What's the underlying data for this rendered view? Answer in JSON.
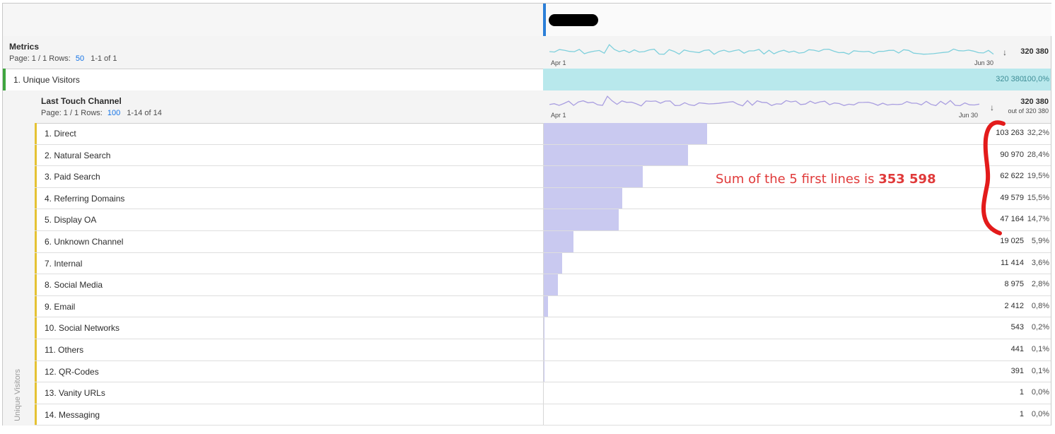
{
  "header": {},
  "metrics_panel": {
    "title": "Metrics",
    "page_label": "Page: 1 / 1 Rows:",
    "rows_value": "50",
    "range": "1-1 of 1",
    "spark_start": "Apr 1",
    "spark_end": "Jun 30",
    "total": "320 380",
    "sort_icon": "arrow-down-icon",
    "spark_color": "#7fd0dc"
  },
  "unique_visitors": {
    "label": "1. Unique Visitors",
    "value": "320 380",
    "pct": "100,0%",
    "bar_color": "#b8e8ec",
    "marker_color": "#3fa53f"
  },
  "breakdown": {
    "title": "Last Touch Channel",
    "page_label": "Page: 1 / 1 Rows:",
    "rows_value": "100",
    "range": "1-14 of 14",
    "spark_start": "Apr 1",
    "spark_end": "Jun 30",
    "total": "320 380",
    "out_of": "out of 320 380",
    "spark_color": "#a99ee0",
    "side_label": "Unique Visitors",
    "bar_color": "#c9c9f0",
    "marker_color": "#e5c234"
  },
  "rows": [
    {
      "label": "1. Direct",
      "value": "103 263",
      "pct": "32,2%",
      "share": 0.322
    },
    {
      "label": "2. Natural Search",
      "value": "90 970",
      "pct": "28,4%",
      "share": 0.284
    },
    {
      "label": "3. Paid Search",
      "value": "62 622",
      "pct": "19,5%",
      "share": 0.195
    },
    {
      "label": "4. Referring Domains",
      "value": "49 579",
      "pct": "15,5%",
      "share": 0.155
    },
    {
      "label": "5. Display OA",
      "value": "47 164",
      "pct": "14,7%",
      "share": 0.147
    },
    {
      "label": "6. Unknown Channel",
      "value": "19 025",
      "pct": "5,9%",
      "share": 0.059
    },
    {
      "label": "7. Internal",
      "value": "11 414",
      "pct": "3,6%",
      "share": 0.036
    },
    {
      "label": "8. Social Media",
      "value": "8 975",
      "pct": "2,8%",
      "share": 0.028
    },
    {
      "label": "9. Email",
      "value": "2 412",
      "pct": "0,8%",
      "share": 0.008
    },
    {
      "label": "10. Social Networks",
      "value": "543",
      "pct": "0,2%",
      "share": 0.002
    },
    {
      "label": "11. Others",
      "value": "441",
      "pct": "0,1%",
      "share": 0.001
    },
    {
      "label": "12. QR-Codes",
      "value": "391",
      "pct": "0,1%",
      "share": 0.001
    },
    {
      "label": "13. Vanity URLs",
      "value": "1",
      "pct": "0,0%",
      "share": 0.0
    },
    {
      "label": "14. Messaging",
      "value": "1",
      "pct": "0,0%",
      "share": 0.0
    }
  ],
  "annotation": {
    "text": "Sum of the 5 first lines is ",
    "highlight": "353 598",
    "color": "#e03a3a"
  }
}
